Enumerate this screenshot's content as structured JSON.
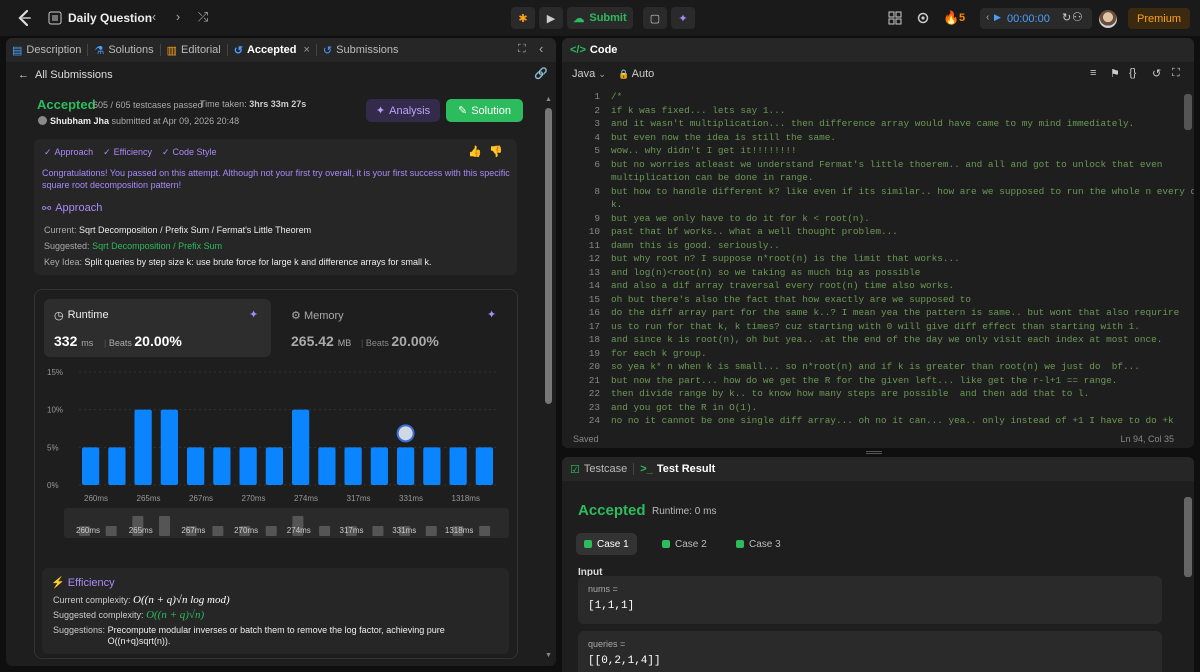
{
  "topbar": {
    "title": "Daily Question",
    "submit_label": "Submit",
    "streak_count": "5",
    "timer": "00:00:00",
    "premium_label": "Premium"
  },
  "left_tabs": [
    {
      "label": "Description"
    },
    {
      "label": "Solutions"
    },
    {
      "label": "Editorial"
    },
    {
      "label": "Accepted"
    },
    {
      "label": "Submissions"
    }
  ],
  "submission": {
    "back_label": "All Submissions",
    "status": "Accepted",
    "passed": "605 / 605 testcases passed",
    "time_label": "Time taken:",
    "time_value": "3hrs 33m 27s",
    "user": "Shubham Jha",
    "submitted_text": "submitted at Apr 09, 2026 20:48",
    "analysis_label": "Analysis",
    "solution_label": "Solution"
  },
  "feedback": {
    "tags": [
      "Approach",
      "Efficiency",
      "Code Style"
    ],
    "congrats": "Congratulations! You passed on this attempt. Although not your first try overall, it is your first success with this specific square root decomposition pattern!",
    "approach_title": "Approach",
    "current_label": "Current:",
    "current_value": "Sqrt Decomposition  /  Prefix Sum  /  Fermat's Little Theorem",
    "suggested_label": "Suggested:",
    "suggested_value": "Sqrt Decomposition  /  Prefix Sum",
    "keyidea_label": "Key Idea:",
    "keyidea_value": "Split queries by step size k: use brute force for large k and difference arrays for small k."
  },
  "runtime": {
    "label": "Runtime",
    "value": "332",
    "unit": "ms",
    "beats_label": "Beats",
    "beats_value": "20.00%"
  },
  "memory": {
    "label": "Memory",
    "value": "265.42",
    "unit": "MB",
    "beats_label": "Beats",
    "beats_value": "20.00%"
  },
  "chart_data": {
    "type": "bar",
    "y_ticks": [
      "15%",
      "10%",
      "5%",
      "0%"
    ],
    "ylim": [
      0,
      15
    ],
    "values": [
      5,
      5,
      10,
      10,
      5,
      5,
      5,
      5,
      10,
      5,
      5,
      5,
      5,
      5,
      5,
      5
    ],
    "highlight_index": 12,
    "x_ticks": [
      "260ms",
      "265ms",
      "267ms",
      "270ms",
      "274ms",
      "317ms",
      "331ms",
      "1318ms"
    ],
    "mini_values": [
      1,
      1,
      2,
      2,
      1,
      1,
      1,
      1,
      2,
      1,
      1,
      1,
      1,
      1,
      1,
      1
    ]
  },
  "efficiency": {
    "title": "Efficiency",
    "current_label": "Current complexity:",
    "current_value": "O((n + q)√n log mod)",
    "suggested_label": "Suggested complexity:",
    "suggested_value": "O((n + q)√n)",
    "suggestions_label": "Suggestions:",
    "suggestions_line1": "Precompute modular inverses or batch them to remove the log factor, achieving pure",
    "suggestions_line2": "O((n+q)sqrt(n))."
  },
  "code": {
    "tab_label": "Code",
    "language": "Java",
    "mode": "Auto",
    "status": "Saved",
    "cursor": "Ln 94, Col 35",
    "lines": [
      {
        "n": "1",
        "t": "/*"
      },
      {
        "n": "2",
        "t": "if k was fixed... lets say 1..."
      },
      {
        "n": "3",
        "t": "and it wasn't multiplication... then difference array would have came to my mind immediately."
      },
      {
        "n": "4",
        "t": "but even now the idea is still the same."
      },
      {
        "n": "5",
        "t": "wow.. why didn't I get it!!!!!!!!"
      },
      {
        "n": "6",
        "t": "but no worries atleast we understand Fermat's little thoerem.. and all and got to unlock that even"
      },
      {
        "n": "",
        "t": "multiplication can be done in range."
      },
      {
        "n": "8",
        "t": "but how to handle different k? like even if its similar.. how are we supposed to run the whole n every diff"
      },
      {
        "n": "",
        "t": "k."
      },
      {
        "n": "9",
        "t": "but yea we only have to do it for k < root(n)."
      },
      {
        "n": "10",
        "t": "past that bf works.. what a well thought problem..."
      },
      {
        "n": "11",
        "t": "damn this is good. seriously.."
      },
      {
        "n": "12",
        "t": "but why root n? I suppose n*root(n) is the limit that works..."
      },
      {
        "n": "13",
        "t": "and log(n)<root(n) so we taking as much big as possible"
      },
      {
        "n": "14",
        "t": "and also a dif array traversal every root(n) time also works."
      },
      {
        "n": "15",
        "t": "oh but there's also the fact that how exactly are we supposed to"
      },
      {
        "n": "16",
        "t": "do the diff array part for the same k..? I mean yea the pattern is same.. but wont that also requrire"
      },
      {
        "n": "17",
        "t": "us to run for that k, k times? cuz starting with 0 will give diff effect than starting with 1."
      },
      {
        "n": "18",
        "t": "and since k is root(n), oh but yea.. .at the end of the day we only visit each index at most once."
      },
      {
        "n": "19",
        "t": "for each k group."
      },
      {
        "n": "20",
        "t": "so yea k* n when k is small... so n*root(n) and if k is greater than root(n) we just do  bf..."
      },
      {
        "n": "21",
        "t": "but now the part... how do we get the R for the given left... like get the r-l+1 == range."
      },
      {
        "n": "22",
        "t": "then divide range by k.. to know how many steps are possible  and then add that to l."
      },
      {
        "n": "23",
        "t": "and you got the R in O(1)."
      },
      {
        "n": "24",
        "t": "no no it cannot be one single diff array... oh no it can... yea.. only instead of +1 I have to do +k"
      }
    ]
  },
  "testpanel": {
    "tab_testcase": "Testcase",
    "tab_result": "Test Result",
    "status": "Accepted",
    "runtime": "Runtime: 0 ms",
    "cases": [
      "Case 1",
      "Case 2",
      "Case 3"
    ],
    "input_label": "Input",
    "inputs": [
      {
        "name": "nums =",
        "value": "[1,1,1]"
      },
      {
        "name": "queries =",
        "value": "[[0,2,1,4]]"
      }
    ]
  }
}
